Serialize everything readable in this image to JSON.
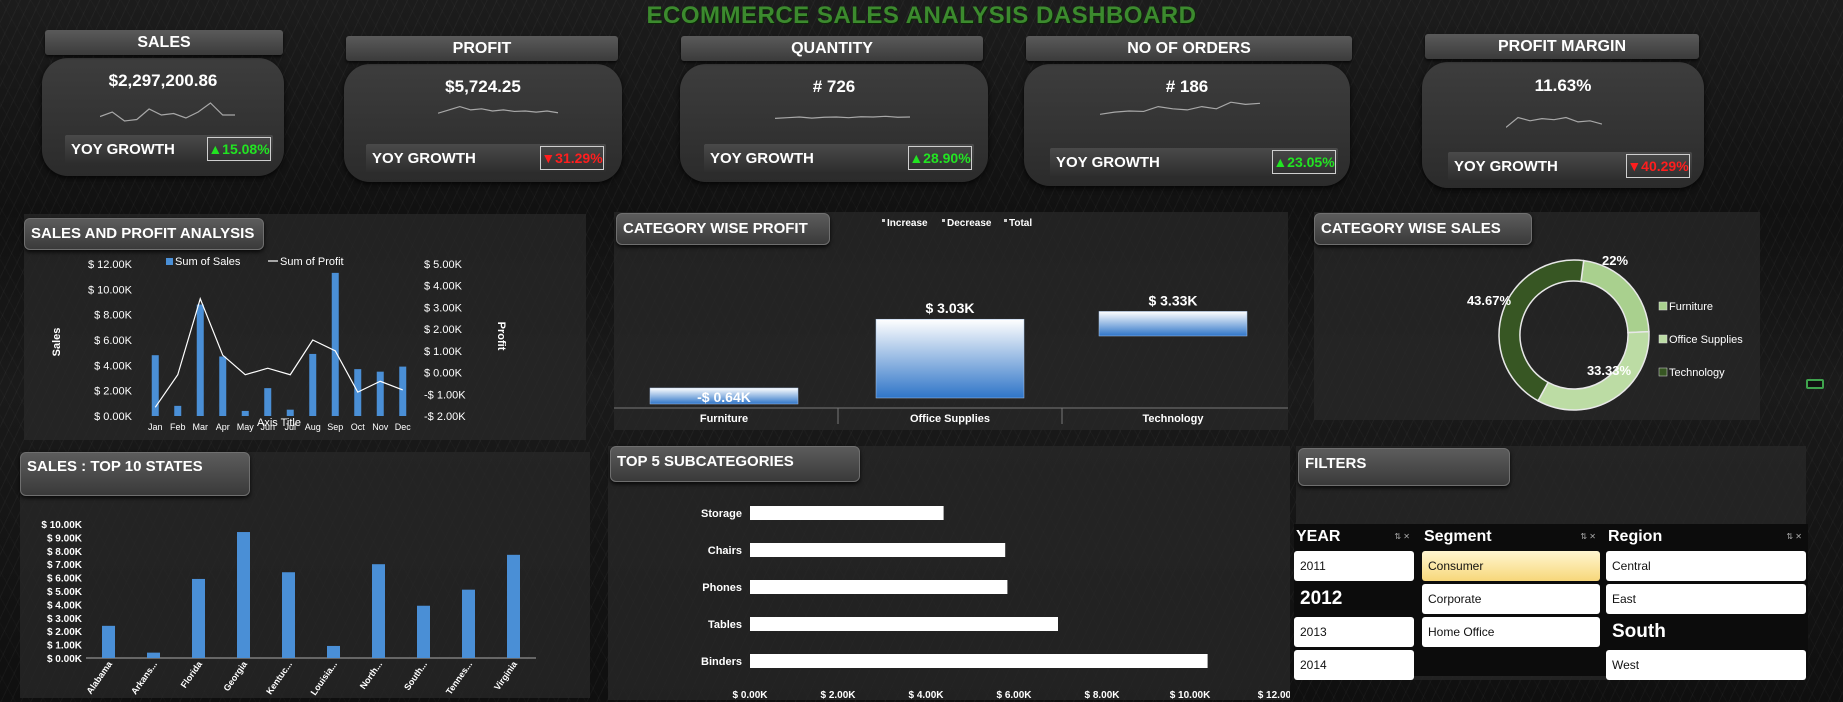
{
  "dashboard_title": "ECOMMERCE SALES ANALYSIS DASHBOARD",
  "kpis": [
    {
      "label": "SALES",
      "value": "$2,297,200.86",
      "yoy_label": "YOY GROWTH",
      "yoy": "▲15.08%",
      "trend": "up",
      "spark": [
        0.45,
        0.6,
        0.3,
        0.35,
        0.7,
        0.5,
        0.55,
        0.4,
        0.6,
        0.9,
        0.5,
        0.5
      ]
    },
    {
      "label": "PROFIT",
      "value": "$5,724.25",
      "yoy_label": "YOY GROWTH",
      "yoy": "▼31.29%",
      "trend": "down",
      "spark": [
        0.4,
        0.55,
        0.7,
        0.55,
        0.6,
        0.5,
        0.55,
        0.48,
        0.5,
        0.45,
        0.5,
        0.42
      ]
    },
    {
      "label": "QUANTITY",
      "value": "# 726",
      "yoy_label": "YOY GROWTH",
      "yoy": "▲28.90%",
      "trend": "up",
      "spark": [
        0.4,
        0.45,
        0.5,
        0.42,
        0.48,
        0.5,
        0.45,
        0.52,
        0.5,
        0.55,
        0.48,
        0.5
      ]
    },
    {
      "label": "NO OF ORDERS",
      "value": "# 186",
      "yoy_label": "YOY GROWTH",
      "yoy": "▲23.05%",
      "trend": "up",
      "spark": [
        0.35,
        0.45,
        0.5,
        0.48,
        0.7,
        0.6,
        0.55,
        0.7,
        0.6,
        0.9,
        0.8,
        0.85
      ]
    },
    {
      "label": "PROFIT MARGIN",
      "value": "11.63%",
      "yoy_label": "YOY GROWTH",
      "yoy": "▼40.29%",
      "trend": "down",
      "spark": [
        0.3,
        0.75,
        0.6,
        0.7,
        0.65,
        0.75,
        0.55,
        0.6,
        0.45
      ]
    }
  ],
  "panels": {
    "sales_profit": "SALES AND PROFIT ANALYSIS",
    "category_profit": "CATEGORY WISE PROFIT",
    "category_sales": "CATEGORY WISE SALES",
    "top_states": "SALES : TOP 10 STATES",
    "top_subcategories": "TOP 5 SUBCATEGORIES",
    "filters": "FILTERS"
  },
  "chart_data": [
    {
      "id": "sales_profit",
      "type": "bar",
      "categories": [
        "Jan",
        "Feb",
        "Mar",
        "Apr",
        "May",
        "Jun",
        "Jul",
        "Aug",
        "Sep",
        "Oct",
        "Nov",
        "Dec"
      ],
      "series": [
        {
          "name": "Sum of Sales",
          "kind": "bar",
          "axis": "left",
          "color": "#4a8fd6",
          "values": [
            4.8,
            0.8,
            8.8,
            4.7,
            0.4,
            2.2,
            0.5,
            4.9,
            11.3,
            3.7,
            3.5,
            3.9
          ]
        },
        {
          "name": "Sum of Profit",
          "kind": "line",
          "axis": "right",
          "color": "#ffffff",
          "values": [
            -1.6,
            -0.1,
            3.4,
            0.8,
            -0.1,
            0.2,
            -0.1,
            1.5,
            1.0,
            -0.9,
            -0.4,
            -0.8
          ]
        }
      ],
      "yticks_left": [
        "$ 0.00K",
        "$ 2.00K",
        "$ 4.00K",
        "$ 6.00K",
        "$ 8.00K",
        "$ 10.00K",
        "$ 12.00K"
      ],
      "yticks_right": [
        "-$ 2.00K",
        "-$ 1.00K",
        "$ 0.00K",
        "$ 1.00K",
        "$ 2.00K",
        "$ 3.00K",
        "$ 4.00K",
        "$ 5.00K"
      ],
      "ylim_left": [
        0,
        12
      ],
      "ylim_right": [
        -2,
        5
      ],
      "ylabel": "Sales",
      "y2label": "Profit",
      "xlabel": "Axis Title",
      "legend_position": "top"
    },
    {
      "id": "category_profit",
      "type": "bar",
      "subtype": "waterfall",
      "categories": [
        "Furniture",
        "Office Supplies",
        "Technology"
      ],
      "values": [
        -0.64,
        3.03,
        3.33
      ],
      "labels": [
        "-$ 0.64K",
        "$ 3.03K",
        "$ 3.33K"
      ],
      "legend": [
        "Increase",
        "Decrease",
        "Total"
      ],
      "legend_position": "top"
    },
    {
      "id": "category_sales",
      "type": "pie",
      "subtype": "doughnut",
      "labels": [
        "Furniture",
        "Office Supplies",
        "Technology"
      ],
      "values": [
        22.0,
        33.33,
        43.67
      ],
      "value_labels": [
        "22%",
        "33.33%",
        "43.67%"
      ],
      "colors": [
        "#a9d08e",
        "#bcdca4",
        "#375623"
      ],
      "legend_position": "right"
    },
    {
      "id": "top_states",
      "type": "bar",
      "categories": [
        "Alabama",
        "Arkans...",
        "Florida",
        "Georgia",
        "Kentuc...",
        "Louisia...",
        "North...",
        "South...",
        "Tennes...",
        "Virginia"
      ],
      "values": [
        2.4,
        0.4,
        5.9,
        9.4,
        6.4,
        0.9,
        7.0,
        3.9,
        5.1,
        7.7
      ],
      "yticks": [
        "$ 0.00K",
        "$ 1.00K",
        "$ 2.00K",
        "$ 3.00K",
        "$ 4.00K",
        "$ 5.00K",
        "$ 6.00K",
        "$ 7.00K",
        "$ 8.00K",
        "$ 9.00K",
        "$ 10.00K"
      ],
      "ylim": [
        0,
        10
      ],
      "color": "#4a8fd6"
    },
    {
      "id": "top_subcategories",
      "type": "bar",
      "orientation": "horizontal",
      "categories": [
        "Storage",
        "Chairs",
        "Phones",
        "Tables",
        "Binders"
      ],
      "values": [
        4.4,
        5.8,
        5.85,
        7.0,
        10.4
      ],
      "xticks": [
        "$ 0.00K",
        "$ 2.00K",
        "$ 4.00K",
        "$ 6.00K",
        "$ 8.00K",
        "$ 10.00K",
        "$ 12.00K"
      ],
      "xlim": [
        0,
        12
      ],
      "color": "#ffffff"
    }
  ],
  "filters": {
    "year": {
      "title": "YEAR",
      "items": [
        {
          "label": "2011",
          "style": "item"
        },
        {
          "label": "2012",
          "style": "big"
        },
        {
          "label": "2013",
          "style": "item"
        },
        {
          "label": "2014",
          "style": "item"
        }
      ]
    },
    "segment": {
      "title": "Segment",
      "items": [
        {
          "label": "Consumer",
          "style": "sel"
        },
        {
          "label": "Corporate",
          "style": "item"
        },
        {
          "label": "Home Office",
          "style": "item"
        }
      ]
    },
    "region": {
      "title": "Region",
      "items": [
        {
          "label": "Central",
          "style": "item"
        },
        {
          "label": "East",
          "style": "item"
        },
        {
          "label": "South",
          "style": "big"
        },
        {
          "label": "West",
          "style": "item"
        }
      ]
    }
  }
}
